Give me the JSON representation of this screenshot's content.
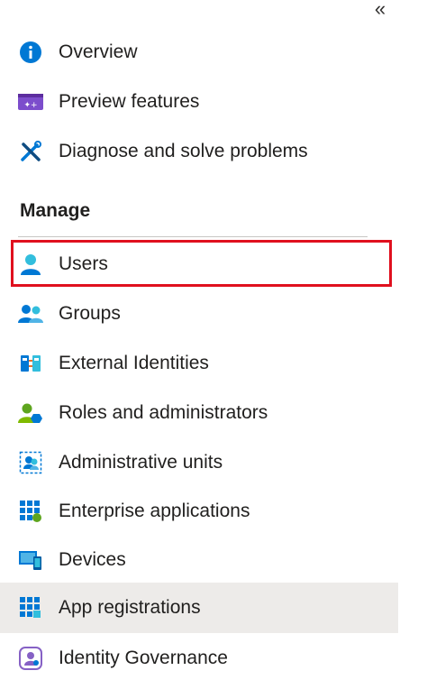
{
  "collapse_glyph": "«",
  "nav": {
    "top_items": [
      {
        "label": "Overview",
        "icon": "info-icon"
      },
      {
        "label": "Preview features",
        "icon": "preview-features-icon"
      },
      {
        "label": "Diagnose and solve problems",
        "icon": "wrench-screwdriver-icon"
      }
    ],
    "manage_header": "Manage",
    "manage_items": [
      {
        "label": "Users",
        "icon": "user-icon",
        "highlighted": true
      },
      {
        "label": "Groups",
        "icon": "groups-icon"
      },
      {
        "label": "External Identities",
        "icon": "external-identities-icon"
      },
      {
        "label": "Roles and administrators",
        "icon": "roles-icon"
      },
      {
        "label": "Administrative units",
        "icon": "admin-units-icon"
      },
      {
        "label": "Enterprise applications",
        "icon": "enterprise-apps-icon"
      },
      {
        "label": "Devices",
        "icon": "devices-icon"
      },
      {
        "label": "App registrations",
        "icon": "app-registrations-icon",
        "selected": true
      },
      {
        "label": "Identity Governance",
        "icon": "identity-governance-icon"
      }
    ]
  },
  "colors": {
    "highlight_border": "#e0101e",
    "selected_bg": "#edebe9",
    "azure_blue": "#0078d4"
  }
}
